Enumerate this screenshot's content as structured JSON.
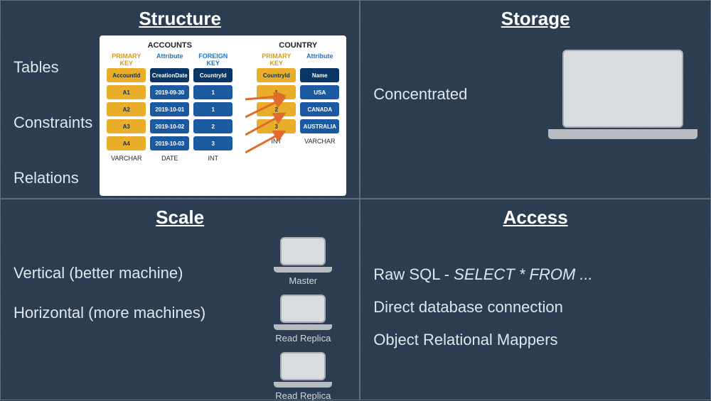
{
  "structure": {
    "title": "Structure",
    "labels": [
      "Tables",
      "Constraints",
      "Relations"
    ],
    "accounts": {
      "table_name": "ACCOUNTS",
      "col_labels": [
        "PRIMARY KEY",
        "Attribute",
        "FOREIGN KEY"
      ],
      "headers": [
        "AccountId",
        "CreationDate",
        "CountryId"
      ],
      "rows": [
        [
          "A1",
          "2019-09-30",
          "1"
        ],
        [
          "A2",
          "2019-10-01",
          "1"
        ],
        [
          "A3",
          "2019-10-02",
          "2"
        ],
        [
          "A4",
          "2019-10-03",
          "3"
        ]
      ],
      "types": [
        "VARCHAR",
        "DATE",
        "INT"
      ]
    },
    "country": {
      "table_name": "COUNTRY",
      "col_labels": [
        "PRIMARY KEY",
        "Attribute"
      ],
      "headers": [
        "CountryId",
        "Name"
      ],
      "rows": [
        [
          "1",
          "USA"
        ],
        [
          "2",
          "CANADA"
        ],
        [
          "3",
          "AUSTRALIA"
        ]
      ],
      "types": [
        "INT",
        "VARCHAR"
      ]
    }
  },
  "storage": {
    "title": "Storage",
    "text": "Concentrated"
  },
  "scale": {
    "title": "Scale",
    "items": [
      "Vertical (better machine)",
      "Horizontal (more machines)"
    ],
    "laptops": [
      "Master",
      "Read Replica",
      "Read Replica"
    ]
  },
  "access": {
    "title": "Access",
    "items_pre": "Raw SQL - ",
    "items_italic": "SELECT * FROM ...",
    "items": [
      "Direct database connection",
      "Object Relational Mappers"
    ]
  }
}
